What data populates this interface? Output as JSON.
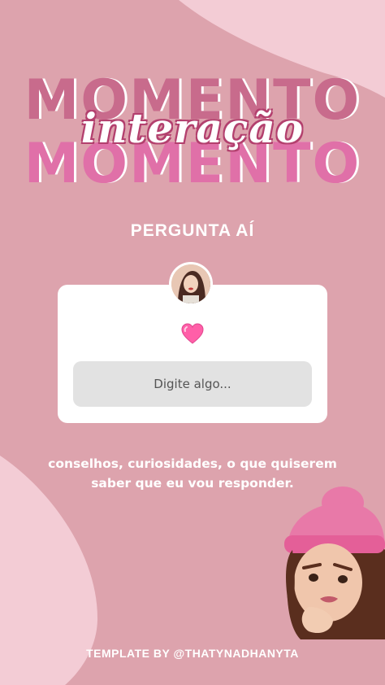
{
  "title": {
    "word_top": "MOMENTO",
    "word_script": "interação",
    "word_bottom": "MOMENTO"
  },
  "headline": "PERGUNTA AÍ",
  "question_box": {
    "avatar_icon": "profile-photo",
    "sticker_icon": "pink-heart-emoji",
    "input_placeholder": "Digite algo..."
  },
  "caption": "conselhos, curiosidades, o que quiserem saber que eu vou responder.",
  "footer": "TEMPLATE BY @THATYNADHANYTA",
  "colors": {
    "background": "#dda3ad",
    "light_blob": "#f3ccd5",
    "card": "#ffffff",
    "input": "#e2e2e2",
    "accent_dark": "#c86b8c",
    "accent_bright": "#e070a8"
  }
}
